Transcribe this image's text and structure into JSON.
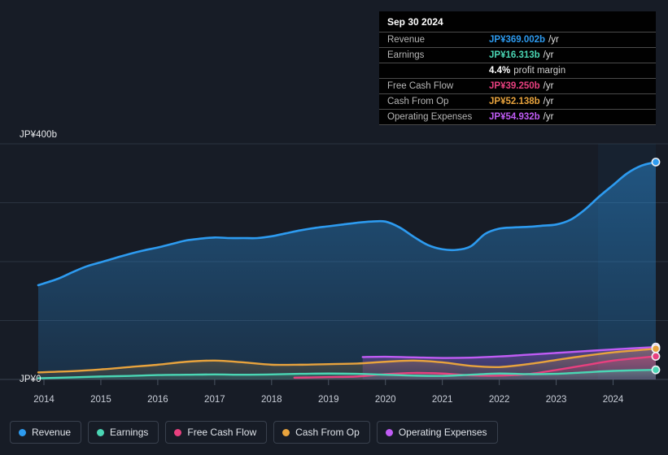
{
  "background_color": "#171c26",
  "tooltip": {
    "title": "Sep 30 2024",
    "rows": [
      {
        "label": "Revenue",
        "value": "JP¥369.002b",
        "suffix": "/yr",
        "color": "#2d9bf0"
      },
      {
        "label": "Earnings",
        "value": "JP¥16.313b",
        "suffix": "/yr",
        "color": "#4ad6b4"
      },
      {
        "label": "",
        "value": "4.4%",
        "suffix": "",
        "sub": "profit margin",
        "color": "#ffffff"
      },
      {
        "label": "Free Cash Flow",
        "value": "JP¥39.250b",
        "suffix": "/yr",
        "color": "#e8407f"
      },
      {
        "label": "Cash From Op",
        "value": "JP¥52.138b",
        "suffix": "/yr",
        "color": "#e8a33d"
      },
      {
        "label": "Operating Expenses",
        "value": "JP¥54.932b",
        "suffix": "/yr",
        "color": "#c05cf5"
      }
    ]
  },
  "y_axis": {
    "top_label": "JP¥400b",
    "zero_label": "JP¥0"
  },
  "legend": {
    "items": [
      {
        "label": "Revenue",
        "color": "#2d9bf0"
      },
      {
        "label": "Earnings",
        "color": "#4ad6b4"
      },
      {
        "label": "Free Cash Flow",
        "color": "#e8407f"
      },
      {
        "label": "Cash From Op",
        "color": "#e8a33d"
      },
      {
        "label": "Operating Expenses",
        "color": "#c05cf5"
      }
    ]
  },
  "chart_data": {
    "type": "area",
    "title": "",
    "xlabel": "",
    "ylabel": "JP¥",
    "ylim": [
      0,
      400
    ],
    "grid": true,
    "grid_values": [
      0,
      100,
      200,
      300,
      400
    ],
    "legend_position": "bottom",
    "categories": [
      "2014",
      "2015",
      "2016",
      "2017",
      "2018",
      "2019",
      "2020",
      "2021",
      "2022",
      "2023",
      "2024"
    ],
    "x_tick_labels": [
      "2014",
      "2015",
      "2016",
      "2017",
      "2018",
      "2019",
      "2020",
      "2021",
      "2022",
      "2023",
      "2024"
    ],
    "units": "JP¥ billions per year",
    "series": [
      {
        "name": "Revenue",
        "color": "#2d9bf0",
        "x": [
          2013.9,
          2014.25,
          2014.5,
          2014.75,
          2015.0,
          2015.25,
          2015.5,
          2015.75,
          2016.0,
          2016.25,
          2016.5,
          2016.75,
          2017.0,
          2017.25,
          2017.5,
          2017.75,
          2018.0,
          2018.25,
          2018.5,
          2018.75,
          2019.0,
          2019.25,
          2019.5,
          2019.75,
          2020.0,
          2020.25,
          2020.5,
          2020.75,
          2021.0,
          2021.25,
          2021.5,
          2021.75,
          2022.0,
          2022.25,
          2022.5,
          2022.75,
          2023.0,
          2023.25,
          2023.5,
          2023.75,
          2024.0,
          2024.25,
          2024.5,
          2024.75
        ],
        "values": [
          160,
          171,
          182,
          192,
          199,
          206,
          213,
          219,
          224,
          230,
          236,
          239,
          241,
          240,
          240,
          240,
          243,
          248,
          253,
          257,
          260,
          263,
          266,
          268,
          268,
          258,
          242,
          228,
          221,
          220,
          226,
          247,
          256,
          258,
          259,
          261,
          263,
          271,
          288,
          310,
          330,
          350,
          363,
          369.002
        ],
        "end_value": 369.002
      },
      {
        "name": "Earnings",
        "color": "#4ad6b4",
        "x": [
          2013.9,
          2014.5,
          2015.0,
          2015.5,
          2016.0,
          2016.5,
          2017.0,
          2017.5,
          2018.0,
          2018.5,
          2019.0,
          2019.5,
          2020.0,
          2020.5,
          2021.0,
          2021.5,
          2022.0,
          2022.5,
          2023.0,
          2023.5,
          2024.0,
          2024.75
        ],
        "values": [
          2.0,
          3.5,
          5.0,
          6.0,
          7.5,
          8.0,
          8.5,
          8.0,
          8.5,
          9.5,
          10.0,
          9.5,
          8.0,
          6.5,
          6.0,
          8.0,
          10.0,
          9.0,
          9.5,
          12.0,
          14.5,
          16.313
        ],
        "end_value": 16.313
      },
      {
        "name": "Free Cash Flow",
        "color": "#e8407f",
        "x": [
          2018.4,
          2018.75,
          2019.0,
          2019.5,
          2020.0,
          2020.5,
          2021.0,
          2021.5,
          2022.0,
          2022.5,
          2023.0,
          2023.5,
          2024.0,
          2024.75
        ],
        "values": [
          3.0,
          3.5,
          4.0,
          5.0,
          9.0,
          11.0,
          10.0,
          7.0,
          6.5,
          9.0,
          16.0,
          24.0,
          32.0,
          39.25
        ],
        "end_value": 39.25
      },
      {
        "name": "Cash From Op",
        "color": "#e8a33d",
        "x": [
          2013.9,
          2014.5,
          2015.0,
          2015.5,
          2016.0,
          2016.5,
          2017.0,
          2017.5,
          2018.0,
          2018.5,
          2019.0,
          2019.5,
          2020.0,
          2020.5,
          2021.0,
          2021.5,
          2022.0,
          2022.5,
          2023.0,
          2023.5,
          2024.0,
          2024.75
        ],
        "values": [
          12.0,
          14.0,
          17.0,
          21.0,
          25.0,
          30.0,
          32.0,
          29.0,
          25.0,
          25.0,
          26.0,
          27.0,
          30.0,
          32.0,
          29.0,
          23.0,
          21.0,
          26.0,
          33.0,
          40.0,
          46.0,
          52.138
        ],
        "end_value": 52.138
      },
      {
        "name": "Operating Expenses",
        "color": "#c05cf5",
        "x": [
          2019.6,
          2020.0,
          2020.5,
          2021.0,
          2021.5,
          2022.0,
          2022.5,
          2023.0,
          2023.5,
          2024.0,
          2024.75
        ],
        "values": [
          38.0,
          38.5,
          37.5,
          36.5,
          37.0,
          39.0,
          42.0,
          45.0,
          48.0,
          51.0,
          54.932
        ],
        "end_value": 54.932
      }
    ]
  }
}
